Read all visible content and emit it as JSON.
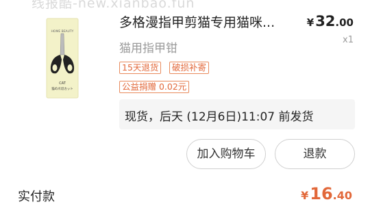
{
  "watermark": "线报酷-new.xianbao.fun",
  "product": {
    "image_icon": "cat-nail-clipper-image",
    "image_brand_text": "HOME BEAUTY",
    "image_caption_text": "猫の爪切カット",
    "title": "多格漫指甲剪猫专用猫咪...",
    "subtitle": "猫用指甲钳",
    "price_symbol": "¥",
    "price_int": "32",
    "price_dec": ".00",
    "quantity": "x1"
  },
  "tags": {
    "return": "15天退货",
    "damage": "破损补寄",
    "charity": "公益捐赠 0.02元"
  },
  "shipping": {
    "text": "现货，后天 (12月6日)11:07 前发货"
  },
  "actions": {
    "add_to_cart": "加入购物车",
    "refund": "退款"
  },
  "summary": {
    "paid_label": "实付款",
    "amount_symbol": "¥",
    "amount_int": "16",
    "amount_dec": ".40"
  },
  "colors": {
    "accent": "#e2683a",
    "tag_border": "#e88a5c",
    "muted": "#9a9a9a",
    "ship_bg": "#f5f5f5"
  }
}
